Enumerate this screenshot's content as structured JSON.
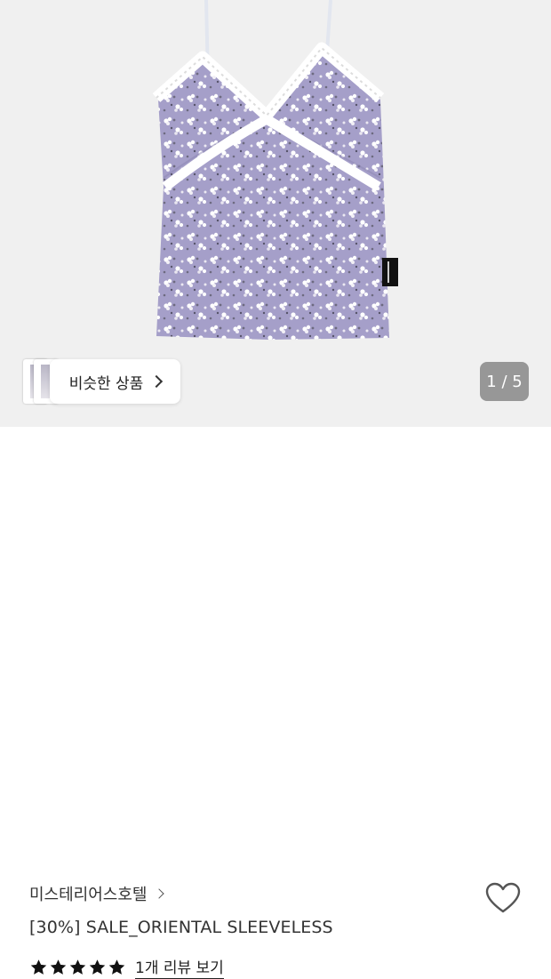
{
  "gallery": {
    "similar_button_label": "비슷한 상품",
    "page_counter": "1 / 5",
    "current_image": 1,
    "total_images": 5
  },
  "product": {
    "brand": "미스테리어스호텔",
    "title": "[30%] SALE_ORIENTAL SLEEVELESS",
    "rating": 5,
    "review_link_label": "1개 리뷰 보기"
  },
  "colors": {
    "gallery_background": "#f0f0f0",
    "garment": "#a59fc9",
    "lace": "#ffffff",
    "counter_background": "#878787"
  },
  "icons": {
    "wishlist": "heart-outline-icon",
    "star": "star-filled-icon",
    "brand_chevron": "chevron-right-icon",
    "similar_chevron": "chevron-right-icon"
  }
}
